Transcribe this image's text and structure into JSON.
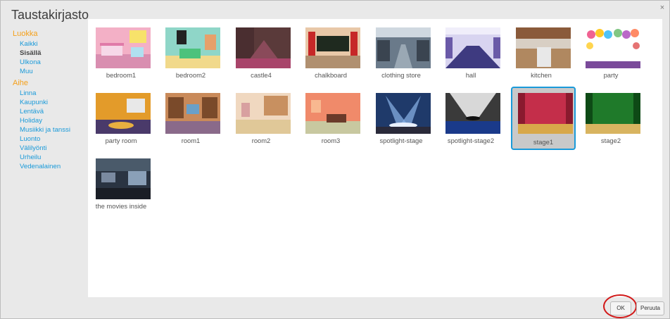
{
  "dialog": {
    "title": "Taustakirjasto",
    "close": "×"
  },
  "sidebar": {
    "category_heading": "Luokka",
    "categories": [
      {
        "label": "Kaikki"
      },
      {
        "label": "Sisällä",
        "selected": true
      },
      {
        "label": "Ulkona"
      },
      {
        "label": "Muu"
      }
    ],
    "theme_heading": "Aihe",
    "themes": [
      {
        "label": "Linna"
      },
      {
        "label": "Kaupunki"
      },
      {
        "label": "Lentävä"
      },
      {
        "label": "Holiday"
      },
      {
        "label": "Musiikki ja tanssi"
      },
      {
        "label": "Luonto"
      },
      {
        "label": "Välilyönti"
      },
      {
        "label": "Urheilu"
      },
      {
        "label": "Vedenalainen"
      }
    ]
  },
  "backdrops": [
    {
      "name": "bedroom1"
    },
    {
      "name": "bedroom2"
    },
    {
      "name": "castle4"
    },
    {
      "name": "chalkboard"
    },
    {
      "name": "clothing store"
    },
    {
      "name": "hall"
    },
    {
      "name": "kitchen"
    },
    {
      "name": "party"
    },
    {
      "name": "party room"
    },
    {
      "name": "room1"
    },
    {
      "name": "room2"
    },
    {
      "name": "room3"
    },
    {
      "name": "spotlight-stage"
    },
    {
      "name": "spotlight-stage2"
    },
    {
      "name": "stage1",
      "selected": true
    },
    {
      "name": "stage2"
    },
    {
      "name": "the movies inside"
    }
  ],
  "footer": {
    "ok_label": "OK",
    "cancel_label": "Peruuta"
  }
}
